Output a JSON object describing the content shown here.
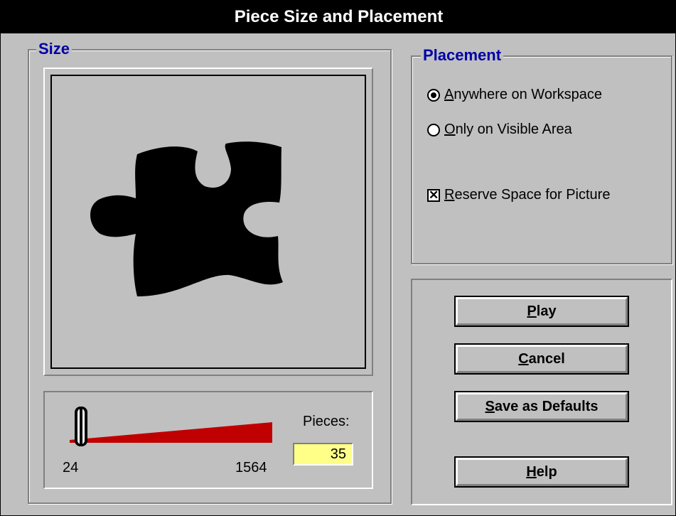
{
  "window": {
    "title": "Piece Size and Placement"
  },
  "size_group": {
    "legend": "Size",
    "slider": {
      "min_label": "24",
      "max_label": "1564",
      "value": 35,
      "min": 24,
      "max": 1564
    },
    "pieces_label": "Pieces:",
    "pieces_value": "35"
  },
  "placement_group": {
    "legend": "Placement",
    "options": [
      {
        "label": "Anywhere on Workspace",
        "accel": "A",
        "rest": "nywhere on Workspace",
        "checked": true
      },
      {
        "label": "Only on Visible Area",
        "accel": "O",
        "rest": "nly on Visible Area",
        "checked": false
      }
    ],
    "reserve": {
      "label": "Reserve Space for Picture",
      "accel": "R",
      "rest": "eserve Space for Picture",
      "checked": true
    }
  },
  "buttons": {
    "play": {
      "accel": "P",
      "rest": "lay",
      "label": "Play"
    },
    "cancel": {
      "accel": "C",
      "rest": "ancel",
      "label": "Cancel"
    },
    "save": {
      "accel": "S",
      "rest": "ave as Defaults",
      "label": "Save as Defaults"
    },
    "help": {
      "accel": "H",
      "rest": "elp",
      "label": "Help"
    }
  },
  "colors": {
    "slider_fill": "#c00000",
    "pieces_bg": "#ffff88",
    "legend": "#0000a8"
  }
}
